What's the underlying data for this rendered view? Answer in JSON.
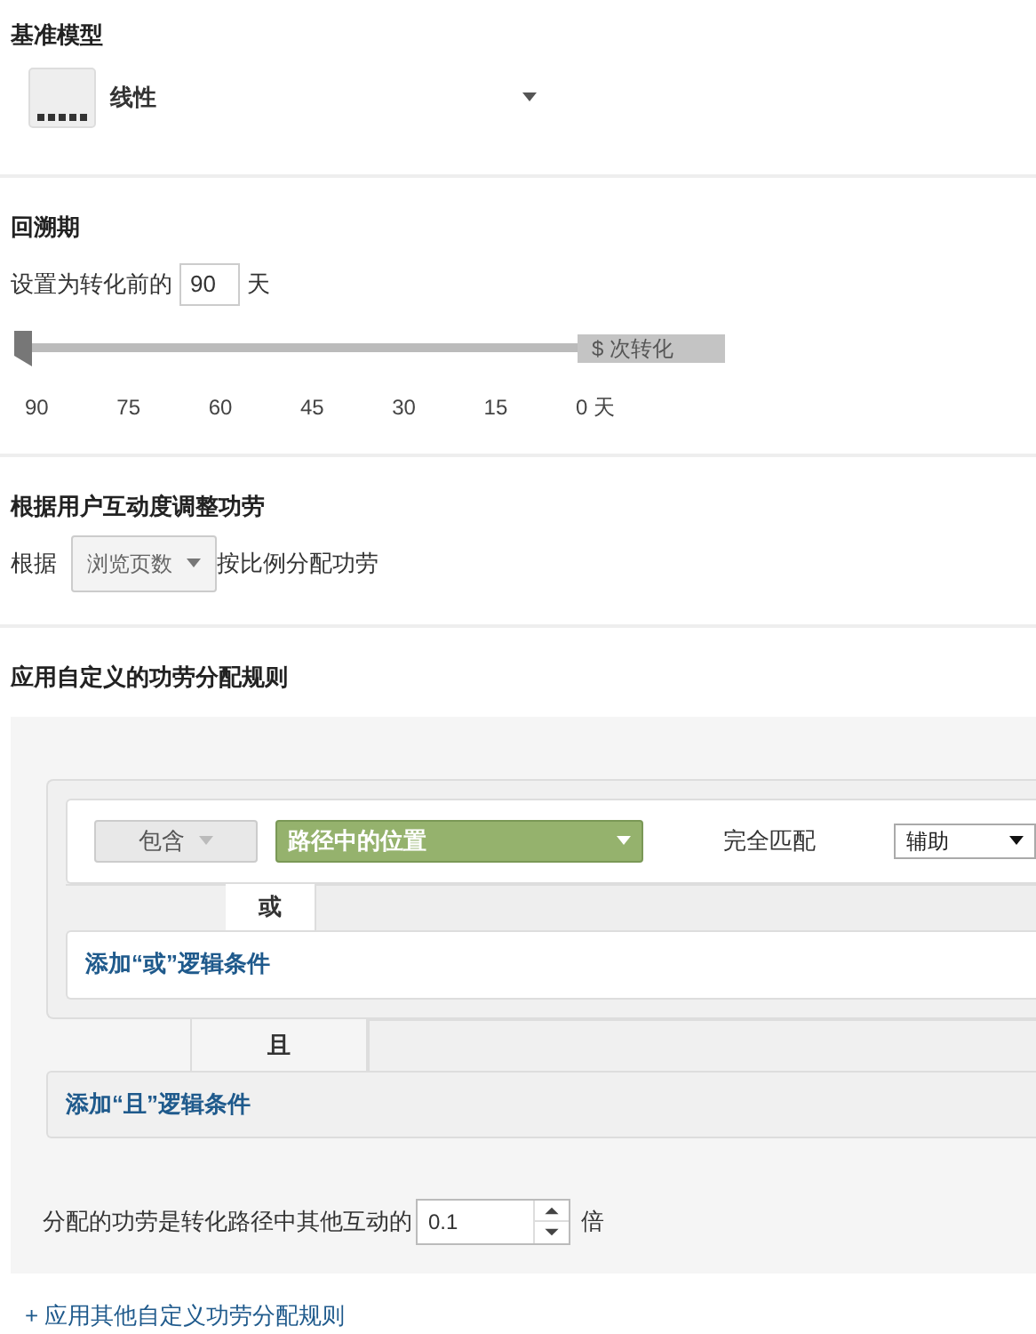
{
  "baseline_model": {
    "title": "基准模型",
    "value": "线性"
  },
  "lookback": {
    "title": "回溯期",
    "prefix": "设置为转化前的",
    "value": "90",
    "suffix": "天",
    "slider": {
      "level": 0,
      "badge": "$ 次转化"
    },
    "ticks": [
      "90",
      "75",
      "60",
      "45",
      "30",
      "15",
      "0 天"
    ]
  },
  "engagement": {
    "title": "根据用户互动度调整功劳",
    "prefix": "根据",
    "select": "浏览页数",
    "suffix": "按比例分配功劳"
  },
  "custom_rules": {
    "title": "应用自定义的功劳分配规则",
    "condition": {
      "operator": "包含",
      "dimension": "路径中的位置",
      "match": "完全匹配",
      "value": "辅助"
    },
    "or_label": "或",
    "add_or": "添加“或”逻辑条件",
    "and_label": "且",
    "add_and": "添加“且”逻辑条件",
    "credit_prefix": "分配的功劳是转化路径中其他互动的",
    "credit_value": "0.1",
    "credit_suffix": "倍"
  },
  "add_rule_link": "+ 应用其他自定义功劳分配规则"
}
